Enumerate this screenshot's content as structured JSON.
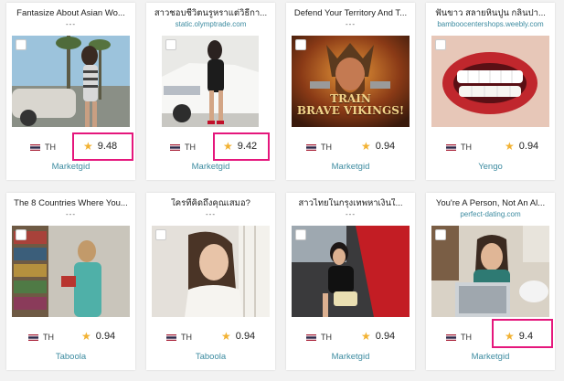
{
  "colors": {
    "accent": "#3c8ba0",
    "highlight": "#e5177c",
    "star": "#f2b233",
    "background": "#f2f2f2"
  },
  "cards": [
    {
      "title": "Fantasize About Asian Wo...",
      "subtitle": "---",
      "country": "TH",
      "rating": "9.48",
      "network": "Marketgid",
      "highlighted": true
    },
    {
      "title": "สาวชอบชีวิตนรูหราแต่วิธีกา...",
      "subtitle": "static.olymptrade.com",
      "country": "TH",
      "rating": "9.42",
      "network": "Marketgid",
      "highlighted": true
    },
    {
      "title": "Defend Your Territory And T...",
      "subtitle": "---",
      "country": "TH",
      "rating": "0.94",
      "network": "Marketgid",
      "highlighted": false,
      "image_text": [
        "TRAIN",
        "BRAVE VIKINGS!"
      ]
    },
    {
      "title": "ฟันขาว สลายหินปูน กลิ่นปา...",
      "subtitle": "bamboocentershops.weebly.com",
      "country": "TH",
      "rating": "0.94",
      "network": "Yengo",
      "highlighted": false
    },
    {
      "title": "The 8 Countries Where You...",
      "subtitle": "---",
      "country": "TH",
      "rating": "0.94",
      "network": "Taboola",
      "highlighted": false
    },
    {
      "title": "ใครที่คิดถึงคุณเสมอ?",
      "subtitle": "---",
      "country": "TH",
      "rating": "0.94",
      "network": "Taboola",
      "highlighted": false
    },
    {
      "title": "สาวไทยในกรุงเทพหาเงินใ...",
      "subtitle": "---",
      "country": "TH",
      "rating": "0.94",
      "network": "Marketgid",
      "highlighted": false
    },
    {
      "title": "You're A Person, Not An Al...",
      "subtitle": "perfect-dating.com",
      "country": "TH",
      "rating": "9.4",
      "network": "Marketgid",
      "highlighted": true
    }
  ],
  "icons": {
    "checkbox": "checkbox-icon",
    "flag": "thailand-flag-icon",
    "star": "star-icon"
  }
}
